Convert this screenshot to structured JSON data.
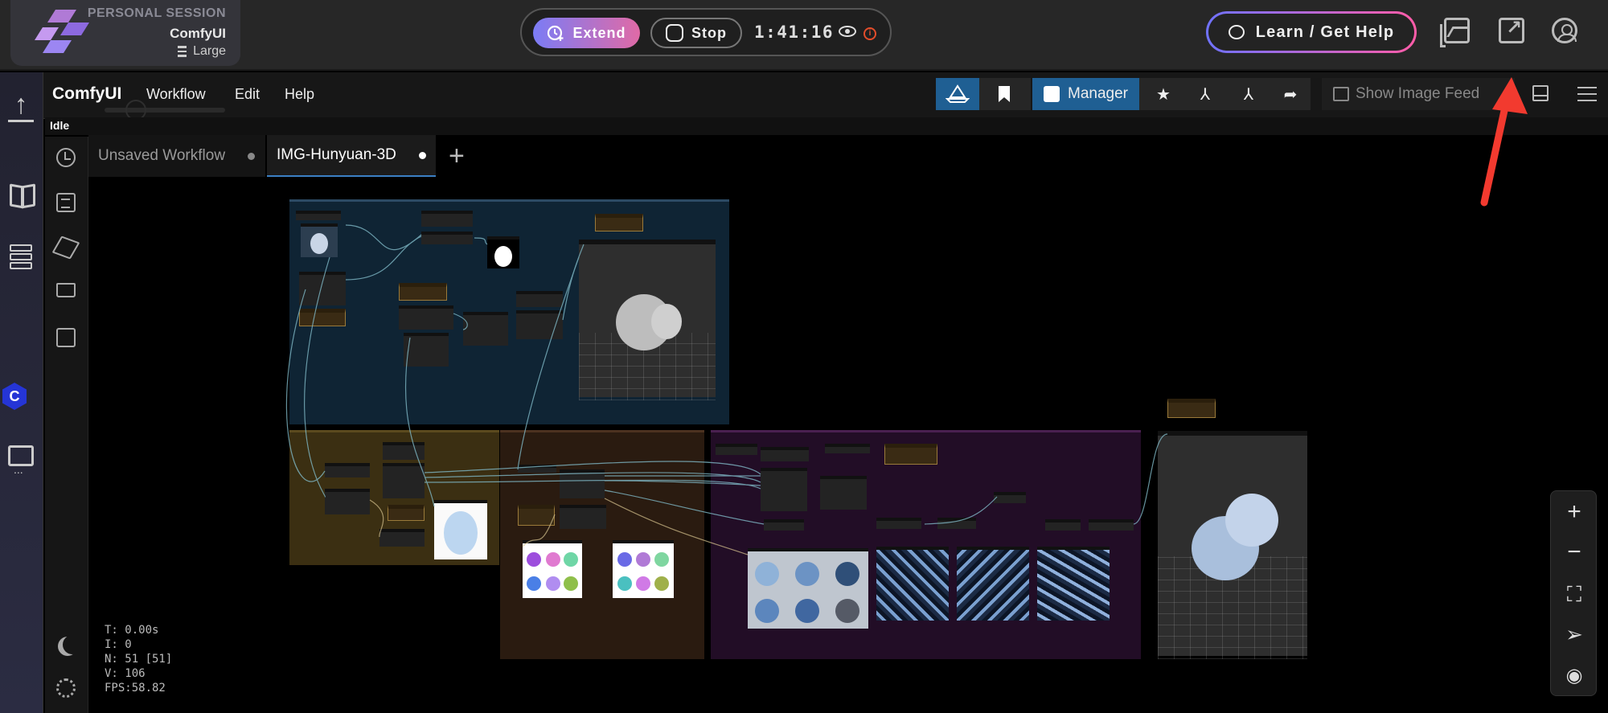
{
  "session": {
    "label": "PERSONAL SESSION",
    "name": "ComfyUI",
    "size": "Large"
  },
  "controls": {
    "extend_label": "Extend",
    "stop_label": "Stop",
    "timer": "1:41:16"
  },
  "help": {
    "label": "Learn / Get Help"
  },
  "menu": {
    "brand": "ComfyUI",
    "items": [
      "Workflow",
      "Edit",
      "Help"
    ],
    "status": "Idle",
    "manager_label": "Manager",
    "show_feed_label": "Show Image Feed"
  },
  "tabs": [
    {
      "label": "Unsaved Workflow",
      "active": false
    },
    {
      "label": "IMG-Hunyuan-3D",
      "active": true
    }
  ],
  "stats": {
    "t": "T: 0.00s",
    "i": "I: 0",
    "n": "N: 51 [51]",
    "v": "V: 106",
    "fps": "FPS:58.82"
  },
  "icons": {
    "extend": "clock-plus-icon",
    "stop": "stop-octagon-icon",
    "visibility": "eye-icon",
    "info": "info-icon",
    "gallery": "gallery-icon",
    "popout": "external-link-icon",
    "account": "user-circle-icon"
  },
  "colors": {
    "accent_blue": "#1f5f93",
    "extend_gradient_start": "#7b7cf5",
    "extend_gradient_end": "#e06aa6",
    "annotation_arrow": "#f23a2f",
    "group_blue": "#0f2434",
    "group_gold": "#3b2f12",
    "group_brown": "#2a1b10",
    "group_purple": "#220d26"
  }
}
